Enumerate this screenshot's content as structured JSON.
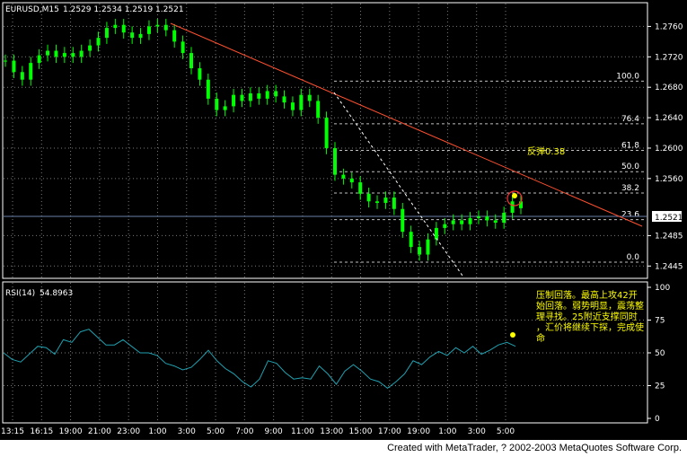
{
  "header": {
    "symbol": "EURUSD,M15",
    "ohlc": "1.2529 1.2534 1.2519 1.2521"
  },
  "rsi_header": {
    "label": "RSI(14)",
    "value": "54.8963"
  },
  "footer": {
    "text": "Created with MetaTrader, ? 2002-2003 MetaQuotes Software Corp."
  },
  "colors": {
    "background": "#000000",
    "grid": "#7a7a7a",
    "candles": "#00ff00",
    "trendline": "#ff5030",
    "fib": "#bfbfbf",
    "rsi_line": "#20a0b0",
    "annotation": "#ffff00",
    "current_price_line": "#6a7fa8"
  },
  "chart_data": [
    {
      "type": "candlestick",
      "symbol": "EURUSD,M15",
      "ylim": [
        1.243,
        1.279
      ],
      "y_ticks": [
        "1.2760",
        "1.2720",
        "1.2680",
        "1.2640",
        "1.2600",
        "1.2560",
        "1.2485",
        "1.2445"
      ],
      "current_price": "1.2521",
      "time_ticks": [
        "13:15",
        "16:15",
        "19:00",
        "21:00",
        "23:00",
        "1:00",
        "3:00",
        "5:00",
        "7:00",
        "9:00",
        "11:00",
        "13:00",
        "15:00",
        "17:00",
        "19:00",
        "1:00",
        "3:00",
        "5:00"
      ],
      "approx_closes": [
        1.2715,
        1.27,
        1.269,
        1.2712,
        1.2722,
        1.2728,
        1.272,
        1.2725,
        1.272,
        1.2728,
        1.2735,
        1.2745,
        1.2758,
        1.2762,
        1.2752,
        1.2745,
        1.275,
        1.276,
        1.2762,
        1.2755,
        1.274,
        1.2725,
        1.2705,
        1.269,
        1.2665,
        1.265,
        1.2655,
        1.267,
        1.2662,
        1.2672,
        1.2665,
        1.2675,
        1.2668,
        1.266,
        1.265,
        1.267,
        1.2662,
        1.264,
        1.26,
        1.2565,
        1.256,
        1.2555,
        1.254,
        1.253,
        1.2528,
        1.2535,
        1.252,
        1.249,
        1.247,
        1.246,
        1.248,
        1.2495,
        1.25,
        1.2505,
        1.25,
        1.2508,
        1.251,
        1.2505,
        1.2502,
        1.2515,
        1.253,
        1.2521
      ],
      "fib_levels": [
        {
          "label": "100.0",
          "price": 1.2688
        },
        {
          "label": "76.4",
          "price": 1.2632
        },
        {
          "label": "61.8",
          "price": 1.2597
        },
        {
          "label": "50.0",
          "price": 1.2569
        },
        {
          "label": "38.2",
          "price": 1.2541
        },
        {
          "label": "23.6",
          "price": 1.2506
        },
        {
          "label": "0.0",
          "price": 1.245
        }
      ],
      "annotation": "反弹0.38"
    },
    {
      "type": "line",
      "name": "RSI(14)",
      "value": "54.8963",
      "ylim": [
        0,
        100
      ],
      "y_ticks": [
        "100",
        "75",
        "50",
        "25",
        "0"
      ],
      "approx_values": [
        50,
        45,
        43,
        49,
        55,
        54,
        49,
        60,
        58,
        66,
        68,
        62,
        56,
        56,
        60,
        55,
        50,
        50,
        48,
        42,
        40,
        37,
        39,
        45,
        52,
        44,
        38,
        34,
        28,
        24,
        30,
        44,
        42,
        35,
        30,
        31,
        30,
        40,
        34,
        26,
        36,
        41,
        36,
        30,
        28,
        23,
        28,
        34,
        44,
        41,
        47,
        51,
        48,
        54,
        50,
        55,
        49,
        52,
        56,
        58,
        55
      ],
      "annotation": "压制回落。最高上攻42开始回落。弱势明显，震荡整理寻找。25附近支撑同时，汇价将继续下探，完成使命"
    }
  ]
}
